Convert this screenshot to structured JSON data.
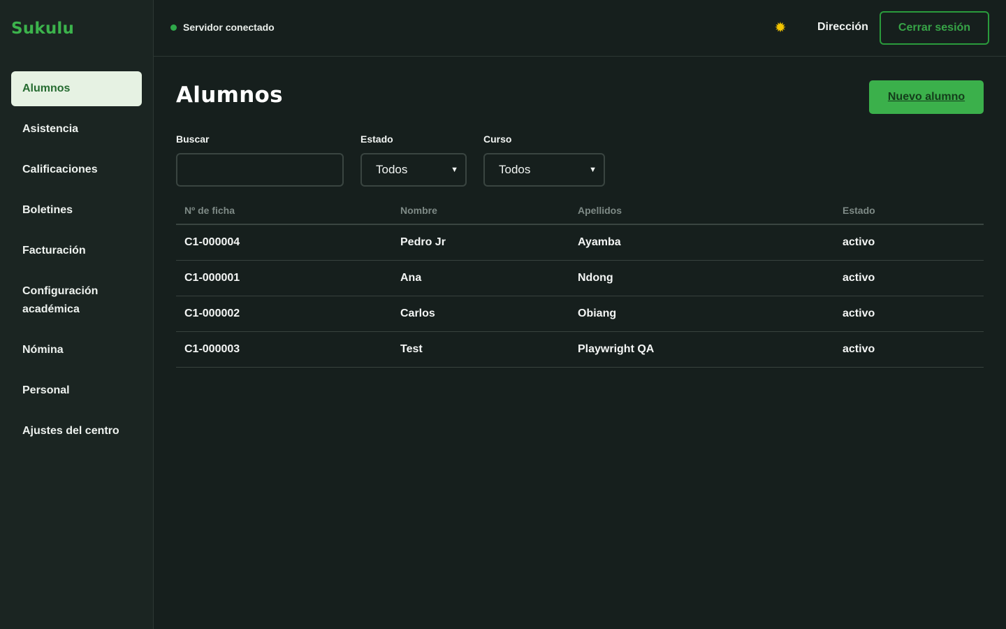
{
  "brand": "Sukulu",
  "sidebar": {
    "items": [
      {
        "label": "Alumnos"
      },
      {
        "label": "Asistencia"
      },
      {
        "label": "Calificaciones"
      },
      {
        "label": "Boletines"
      },
      {
        "label": "Facturación"
      },
      {
        "label": "Configuración académica"
      },
      {
        "label": "Nómina"
      },
      {
        "label": "Personal"
      },
      {
        "label": "Ajustes del centro"
      }
    ]
  },
  "topbar": {
    "status": "Servidor conectado",
    "theme_icon": "sun-icon",
    "role": "Dirección",
    "logout_label": "Cerrar sesión"
  },
  "main": {
    "title": "Alumnos",
    "new_button": "Nuevo alumno",
    "filters": {
      "search_label": "Buscar",
      "search_value": "",
      "estado_label": "Estado",
      "estado_value": "Todos",
      "curso_label": "Curso",
      "curso_value": "Todos"
    },
    "table": {
      "headers": [
        "Nº de ficha",
        "Nombre",
        "Apellidos",
        "Estado"
      ],
      "rows": [
        [
          "C1-000004",
          "Pedro Jr",
          "Ayamba",
          "activo"
        ],
        [
          "C1-000001",
          "Ana",
          "Ndong",
          "activo"
        ],
        [
          "C1-000002",
          "Carlos",
          "Obiang",
          "activo"
        ],
        [
          "C1-000003",
          "Test",
          "Playwright QA",
          "activo"
        ]
      ]
    }
  },
  "colors": {
    "accent": "#3bb04b",
    "background": "#161f1d",
    "sidebar": "#1b2522",
    "active_nav_bg": "#e6f2e3",
    "status_dot": "#2fa84a",
    "sun": "#f2c400"
  }
}
